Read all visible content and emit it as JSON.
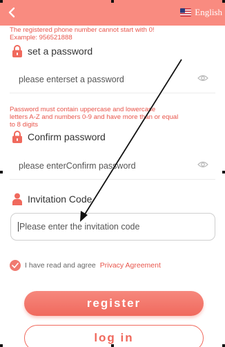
{
  "header": {
    "back_icon": "chevron-left-icon",
    "language_label": "English",
    "flag_icon": "us-flag-icon",
    "bg_color": "#f98b80"
  },
  "phone_hint": {
    "line1": "The registered phone number cannot start with 0!",
    "line2": "Example: 956521888"
  },
  "password": {
    "label": "set a password",
    "icon": "lock-icon",
    "placeholder": "please enterset a password",
    "toggle_icon": "eye-icon"
  },
  "password_hint": {
    "line1": "Password must contain uppercase and lowercase",
    "line2": "letters A-Z and numbers 0-9 and have more than or equal",
    "line3": "to 8 digits"
  },
  "confirm_password": {
    "label": "Confirm password",
    "icon": "lock-icon",
    "placeholder": "please enterConfirm password",
    "toggle_icon": "eye-icon"
  },
  "invitation": {
    "label": "Invitation Code",
    "icon": "user-icon",
    "placeholder": "Please enter the invitation code"
  },
  "agreement": {
    "text": "I have read and agree",
    "link": "Privacy Agreement",
    "checked": true
  },
  "buttons": {
    "register": "register",
    "login": "log in"
  },
  "accent_color": "#f0695d"
}
